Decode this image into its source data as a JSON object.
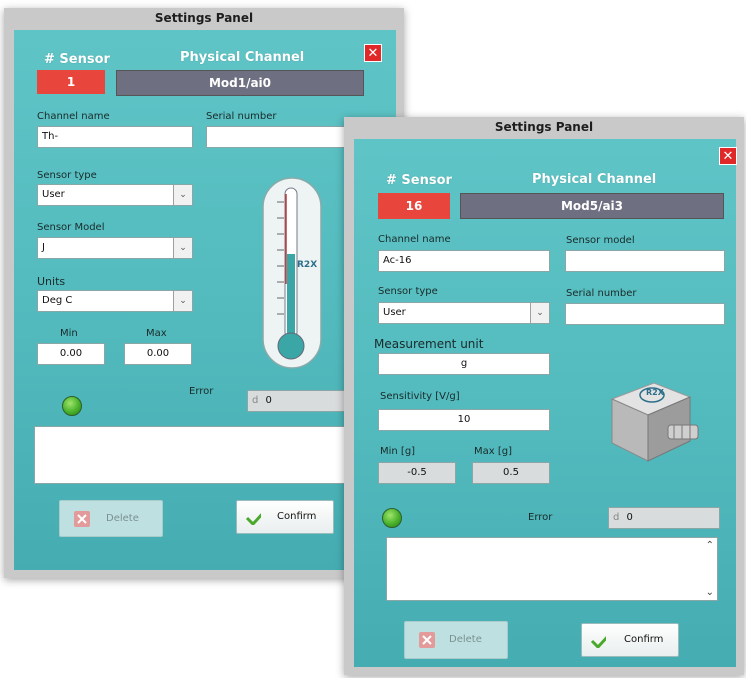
{
  "panel_a": {
    "title": "Settings Panel",
    "sensor_header": "# Sensor",
    "channel_header": "Physical Channel",
    "sensor_number": "1",
    "physical_channel": "Mod1/ai0",
    "channel_name_label": "Channel name",
    "channel_name_value": "Th-",
    "serial_number_label": "Serial number",
    "serial_number_value": "",
    "sensor_type_label": "Sensor type",
    "sensor_type_value": "User",
    "sensor_model_label": "Sensor Model",
    "sensor_model_value": "J",
    "units_label": "Units",
    "units_value": "Deg C",
    "min_label": "Min",
    "min_value": "0.00",
    "max_label": "Max",
    "max_value": "0.00",
    "error_label": "Error",
    "error_prefix": "d",
    "error_value": "0",
    "delete_label": "Delete",
    "confirm_label": "Confirm",
    "close_glyph": "✕",
    "thermometer_logo": "R2X"
  },
  "panel_b": {
    "title": "Settings Panel",
    "sensor_header": "# Sensor",
    "channel_header": "Physical Channel",
    "sensor_number": "16",
    "physical_channel": "Mod5/ai3",
    "channel_name_label": "Channel name",
    "channel_name_value": "Ac-16",
    "sensor_model_label": "Sensor model",
    "sensor_model_value": "",
    "sensor_type_label": "Sensor type",
    "sensor_type_value": "User",
    "serial_number_label": "Serial number",
    "serial_number_value": "",
    "measurement_unit_label": "Measurement unit",
    "measurement_unit_value": "g",
    "sensitivity_label": "Sensitivity [V/g]",
    "sensitivity_value": "10",
    "min_label": "Min [g]",
    "min_value": "-0.5",
    "max_label": "Max [g]",
    "max_value": "0.5",
    "error_label": "Error",
    "error_prefix": "d",
    "error_value": "0",
    "delete_label": "Delete",
    "confirm_label": "Confirm",
    "close_glyph": "✕",
    "sensor_logo": "R2X"
  },
  "icons": {
    "dropdown": "chevron-down-icon",
    "scroll_up": "chevron-up-icon",
    "scroll_down": "chevron-down-icon",
    "status": "status-led-icon",
    "delete": "delete-x-icon",
    "confirm": "checkmark-icon",
    "close": "close-icon"
  },
  "colors": {
    "panel_teal": "#52babd",
    "sensor_red": "#e8453c",
    "channel_grey": "#6e6f80",
    "close_red": "#e12828",
    "led_green": "#49b12a",
    "confirm_green": "#4aa82a"
  }
}
